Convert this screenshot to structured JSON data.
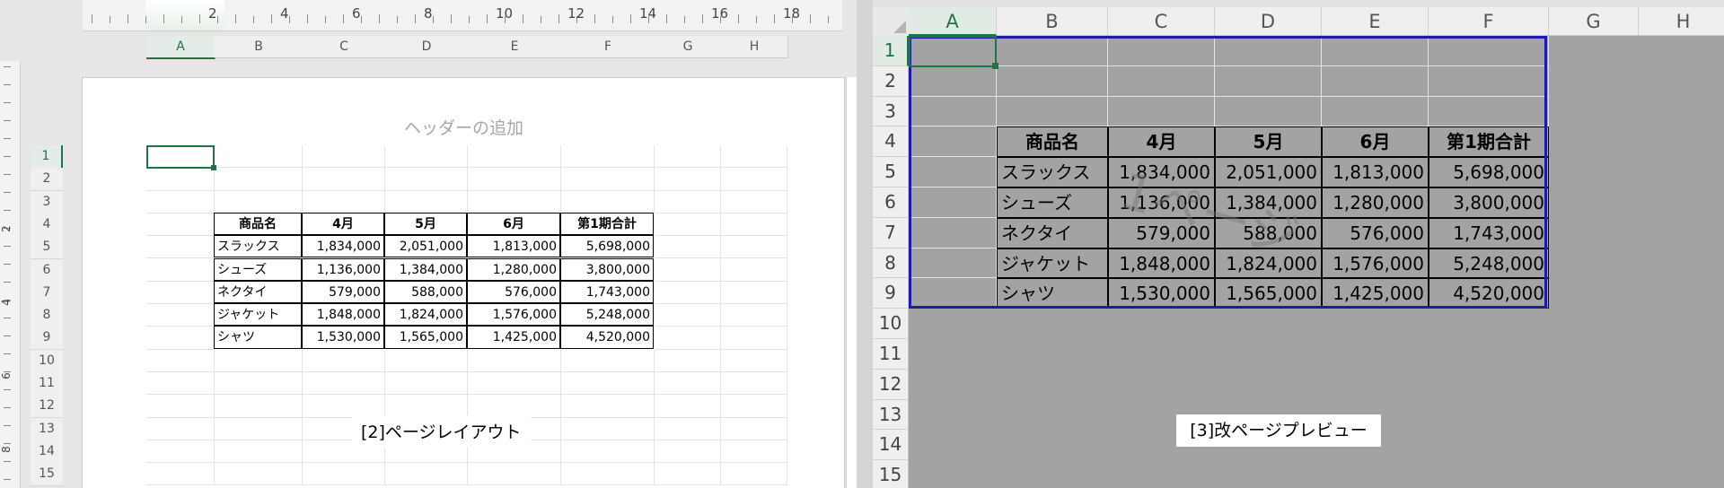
{
  "left_pane": {
    "view_name": "[2]ページレイアウト",
    "header_placeholder": "ヘッダーの追加",
    "ruler_numbers": [
      "2",
      "4",
      "6",
      "8",
      "10",
      "12",
      "14",
      "16",
      "18"
    ],
    "vertical_ruler_numbers": [
      "2",
      "4",
      "6",
      "8"
    ],
    "column_headers": [
      "A",
      "B",
      "C",
      "D",
      "E",
      "F",
      "G",
      "H"
    ],
    "row_headers": [
      "1",
      "2",
      "3",
      "4",
      "5",
      "6",
      "7",
      "8",
      "9",
      "10",
      "11",
      "12",
      "13",
      "14",
      "15"
    ],
    "selected_cell": "A1"
  },
  "right_pane": {
    "view_name": "[3]改ページプレビュー",
    "page_watermark": "1ページ",
    "column_headers": [
      "A",
      "B",
      "C",
      "D",
      "E",
      "F",
      "G",
      "H"
    ],
    "row_headers": [
      "1",
      "2",
      "3",
      "4",
      "5",
      "6",
      "7",
      "8",
      "9",
      "10",
      "11",
      "12",
      "13",
      "14",
      "15"
    ],
    "selected_cell": "A1"
  },
  "table": {
    "headers": [
      "商品名",
      "4月",
      "5月",
      "6月",
      "第1期合計"
    ],
    "rows": [
      [
        "スラックス",
        "1,834,000",
        "2,051,000",
        "1,813,000",
        "5,698,000"
      ],
      [
        "シューズ",
        "1,136,000",
        "1,384,000",
        "1,280,000",
        "3,800,000"
      ],
      [
        "ネクタイ",
        "579,000",
        "588,000",
        "576,000",
        "1,743,000"
      ],
      [
        "ジャケット",
        "1,848,000",
        "1,824,000",
        "1,576,000",
        "5,248,000"
      ],
      [
        "シャツ",
        "1,530,000",
        "1,565,000",
        "1,425,000",
        "4,520,000"
      ]
    ]
  },
  "colors": {
    "excel_green": "#217346",
    "page_break_blue": "#1c1ca8",
    "outside_print_area": "#a3a3a3"
  }
}
